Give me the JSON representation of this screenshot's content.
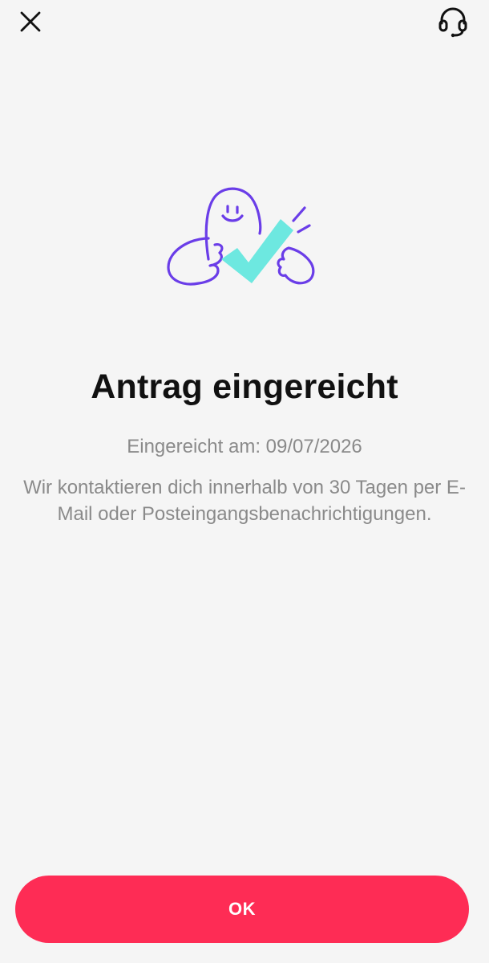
{
  "header": {
    "close_icon": "close-icon",
    "support_icon": "headset-icon"
  },
  "illustration": {
    "name": "mascot-checkmark-illustration",
    "outline_color": "#6a3de8",
    "check_color": "#6de8e0"
  },
  "content": {
    "title": "Antrag eingereicht",
    "submitted_label": "Eingereicht am: 09/07/2026",
    "message": "Wir kontaktieren dich innerhalb von 30 Tagen per E-Mail oder Posteingangsbenachrichtigungen."
  },
  "footer": {
    "ok_label": "OK"
  },
  "colors": {
    "accent": "#fe2c55",
    "background": "#f5f5f5",
    "title": "#111111",
    "secondary_text": "#8a8a8a"
  }
}
